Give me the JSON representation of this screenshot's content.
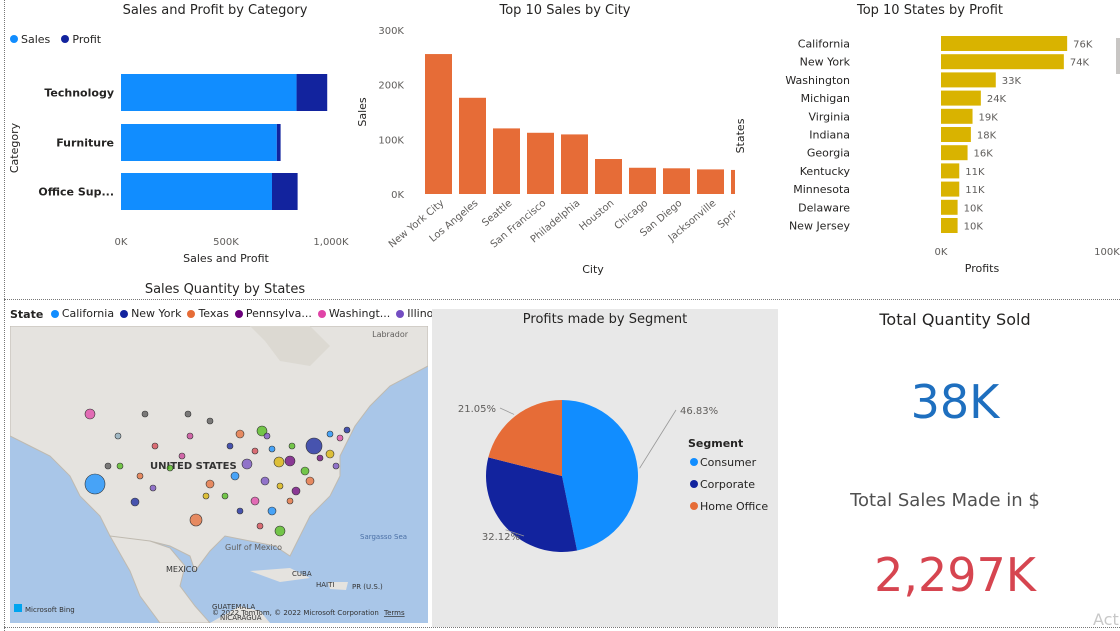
{
  "chart_data": [
    {
      "type": "bar",
      "title": "Sales and Profit by Category",
      "legend": [
        "Sales",
        "Profit"
      ],
      "categories": [
        "Technology",
        "Furniture",
        "Office Sup..."
      ],
      "series": [
        {
          "name": "Sales",
          "values": [
            836000,
            742000,
            719000
          ],
          "color": "#118DFF"
        },
        {
          "name": "Profit",
          "values": [
            146000,
            18000,
            122000
          ],
          "color": "#12239E"
        }
      ],
      "xlabel": "Sales and Profit",
      "ylabel": "Category",
      "xticks": [
        "0K",
        "500K",
        "1,000K"
      ],
      "xlim": [
        0,
        1000000
      ]
    },
    {
      "type": "bar",
      "title": "Top 10 Sales by City",
      "categories": [
        "New York City",
        "Los Angeles",
        "Seattle",
        "San Francisco",
        "Philadelphia",
        "Houston",
        "Chicago",
        "San Diego",
        "Jacksonville",
        "Springfi"
      ],
      "values": [
        256000,
        176000,
        120000,
        112000,
        109000,
        64000,
        48000,
        47000,
        45000,
        44000
      ],
      "color": "#E66C37",
      "xlabel": "City",
      "ylabel": "Sales",
      "yticks": [
        "0K",
        "100K",
        "200K",
        "300K"
      ],
      "ylim": [
        0,
        300000
      ]
    },
    {
      "type": "bar",
      "title": "Top 10 States by Profit",
      "categories": [
        "California",
        "New York",
        "Washington",
        "Michigan",
        "Virginia",
        "Indiana",
        "Georgia",
        "Kentucky",
        "Minnesota",
        "Delaware",
        "New Jersey"
      ],
      "values": [
        76000,
        74000,
        33000,
        24000,
        19000,
        18000,
        16000,
        11000,
        11000,
        10000,
        10000
      ],
      "data_labels": [
        "76K",
        "74K",
        "33K",
        "24K",
        "19K",
        "18K",
        "16K",
        "11K",
        "11K",
        "10K",
        "10K"
      ],
      "color": "#D9B300",
      "xlabel": "Profits",
      "ylabel": "States",
      "xticks": [
        "0K",
        "100K"
      ],
      "xlim": [
        0,
        100000
      ]
    },
    {
      "type": "pie",
      "title": "Profits made by Segment",
      "legend_title": "Segment",
      "labels": [
        "Consumer",
        "Corporate",
        "Home Office"
      ],
      "values": [
        46.83,
        32.12,
        21.05
      ],
      "data_labels": [
        "46.83%",
        "32.12%",
        "21.05%"
      ],
      "colors": [
        "#118DFF",
        "#12239E",
        "#E66C37"
      ]
    }
  ],
  "map": {
    "title": "Sales Quantity by States",
    "legend_label": "State",
    "legend": [
      {
        "name": "California",
        "color": "#118DFF"
      },
      {
        "name": "New York",
        "color": "#12239E"
      },
      {
        "name": "Texas",
        "color": "#E66C37"
      },
      {
        "name": "Pennsylva...",
        "color": "#6B007B"
      },
      {
        "name": "Washingt...",
        "color": "#E044A7"
      },
      {
        "name": "Illinois",
        "color": "#744EC2"
      }
    ],
    "places": {
      "country": "UNITED STATES",
      "labrador": "Labrador",
      "gulf": "Gulf of Mexico",
      "sargasso": "Sargasso Sea",
      "mexico": "MEXICO",
      "cuba": "CUBA",
      "haiti": "HAITI",
      "pr": "PR (U.S.)",
      "guatemala": "GUATEMALA",
      "nicaragua": "NICARAGUA"
    },
    "bing": "Microsoft Bing",
    "copyright": "© 2022 TomTom, © 2022 Microsoft Corporation",
    "terms": "Terms"
  },
  "cards": {
    "qty_title": "Total Quantity Sold",
    "qty_value": "38K",
    "sales_title": "Total Sales Made in $",
    "sales_value": "2,297K",
    "qty_color": "#1E6FBF",
    "sales_color": "#D64550"
  },
  "watermark": "Act"
}
